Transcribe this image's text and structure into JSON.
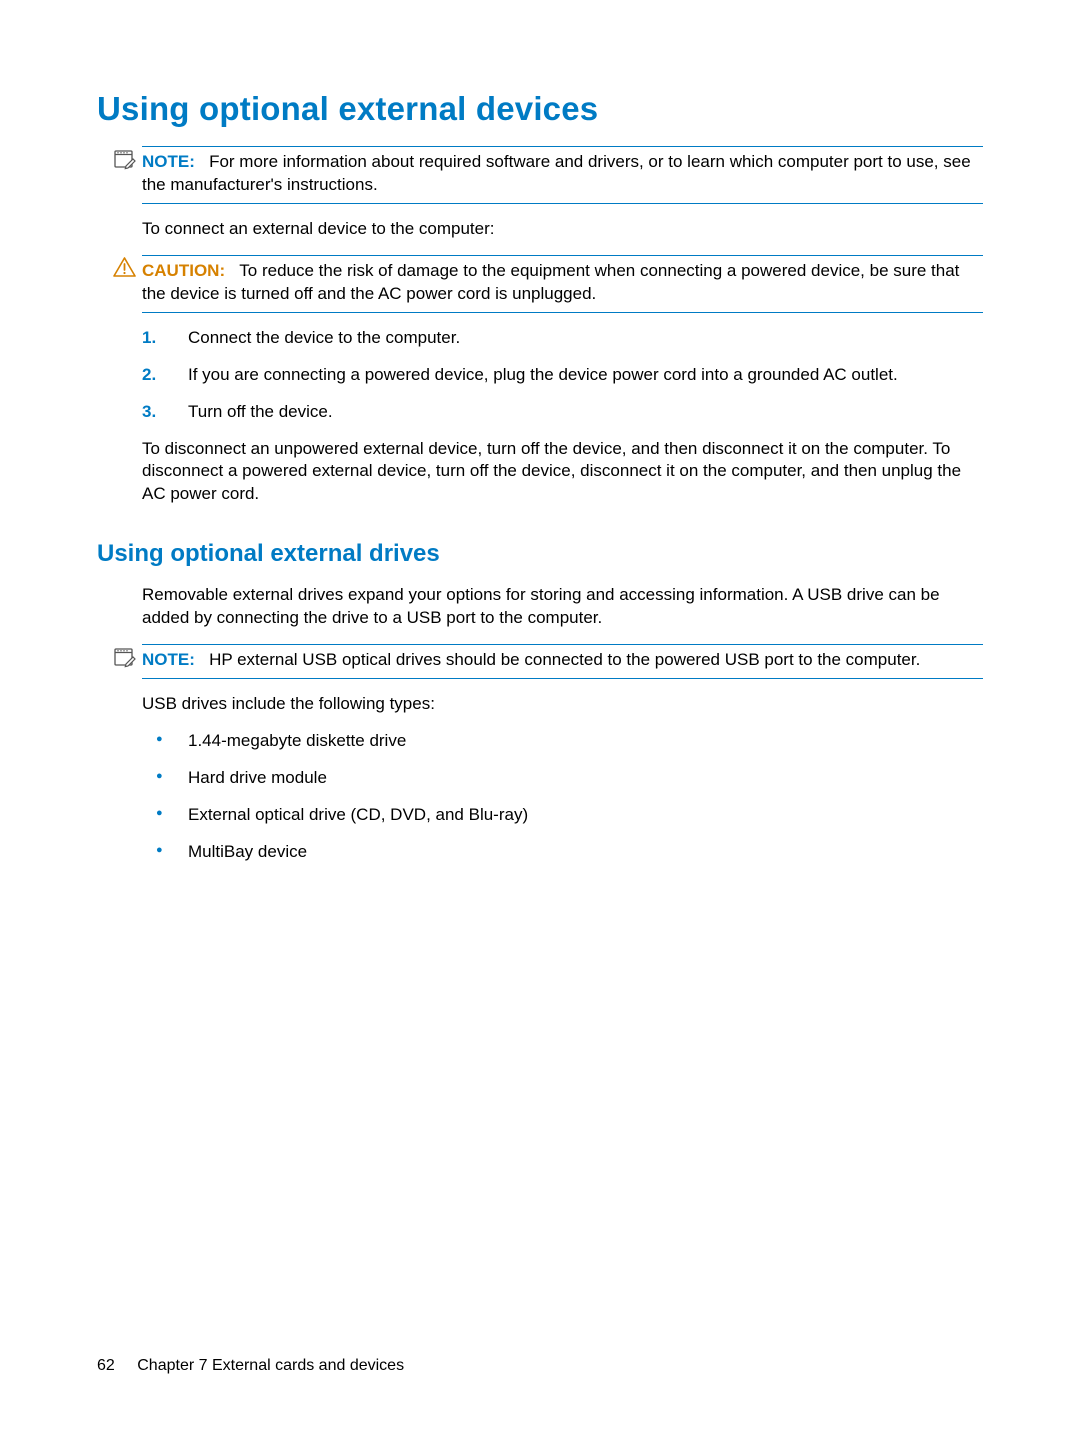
{
  "heading1": "Using optional external devices",
  "note1": {
    "label": "NOTE:",
    "text": "For more information about required software and drivers, or to learn which computer port to use, see the manufacturer's instructions."
  },
  "intro1": "To connect an external device to the computer:",
  "caution1": {
    "label": "CAUTION:",
    "text": "To reduce the risk of damage to the equipment when connecting a powered device, be sure that the device is turned off and the AC power cord is unplugged."
  },
  "steps": [
    {
      "n": "1.",
      "t": "Connect the device to the computer."
    },
    {
      "n": "2.",
      "t": "If you are connecting a powered device, plug the device power cord into a grounded AC outlet."
    },
    {
      "n": "3.",
      "t": "Turn off the device."
    }
  ],
  "para_disconnect": "To disconnect an unpowered external device, turn off the device, and then disconnect it on the computer. To disconnect a powered external device, turn off the device, disconnect it on the computer, and then unplug the AC power cord.",
  "heading2": "Using optional external drives",
  "para_removable": "Removable external drives expand your options for storing and accessing information. A USB drive can be added by connecting the drive to a USB port to the computer.",
  "note2": {
    "label": "NOTE:",
    "text": "HP external USB optical drives should be connected to the powered USB port to the computer."
  },
  "para_usb_types": "USB drives include the following types:",
  "bullets": [
    "1.44-megabyte diskette drive",
    "Hard drive module",
    "External optical drive (CD, DVD, and Blu-ray)",
    "MultiBay device"
  ],
  "footer": {
    "page_number": "62",
    "chapter": "Chapter 7   External cards and devices"
  }
}
